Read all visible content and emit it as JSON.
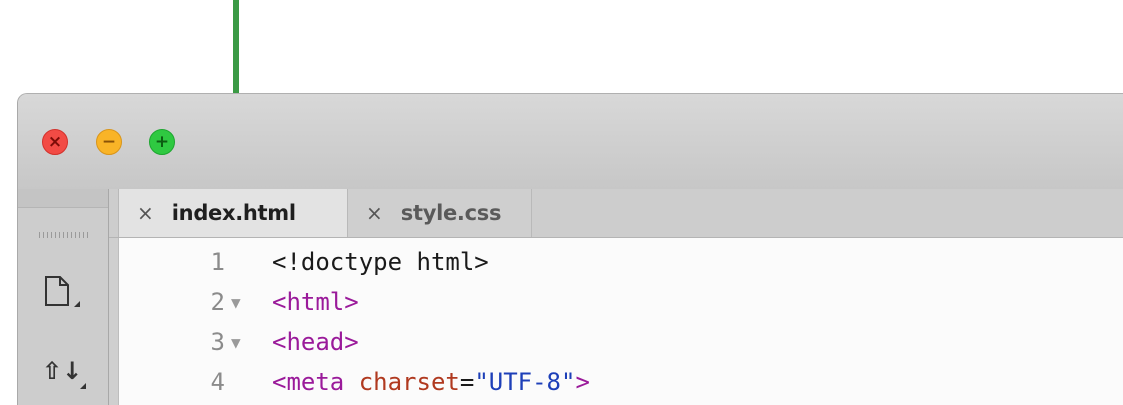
{
  "window": {
    "controls": [
      "close",
      "minimize",
      "maximize"
    ]
  },
  "sidebar": {
    "icons": [
      "new-file-icon",
      "sort-icon"
    ]
  },
  "tabs": [
    {
      "close": "×",
      "label": "index.html",
      "active": true
    },
    {
      "close": "×",
      "label": "style.css",
      "active": false
    }
  ],
  "editor": {
    "lines": [
      {
        "num": "1",
        "fold": "",
        "parts": [
          {
            "t": "<!doctype html>",
            "k": "plain"
          }
        ]
      },
      {
        "num": "2",
        "fold": "▼",
        "parts": [
          {
            "t": "<html>",
            "k": "tag"
          }
        ]
      },
      {
        "num": "3",
        "fold": "▼",
        "parts": [
          {
            "t": "<head>",
            "k": "tag"
          }
        ]
      },
      {
        "num": "4",
        "fold": "",
        "parts": [
          {
            "t": "<meta ",
            "k": "tag"
          },
          {
            "t": "charset",
            "k": "attr"
          },
          {
            "t": "=",
            "k": "plain"
          },
          {
            "t": "\"UTF-8\"",
            "k": "str"
          },
          {
            "t": ">",
            "k": "tag"
          }
        ]
      }
    ]
  },
  "colors": {
    "arrow": "#3b9a45",
    "tag": "#9a1a9a",
    "attr": "#b0391f",
    "string": "#1d3fb8"
  }
}
